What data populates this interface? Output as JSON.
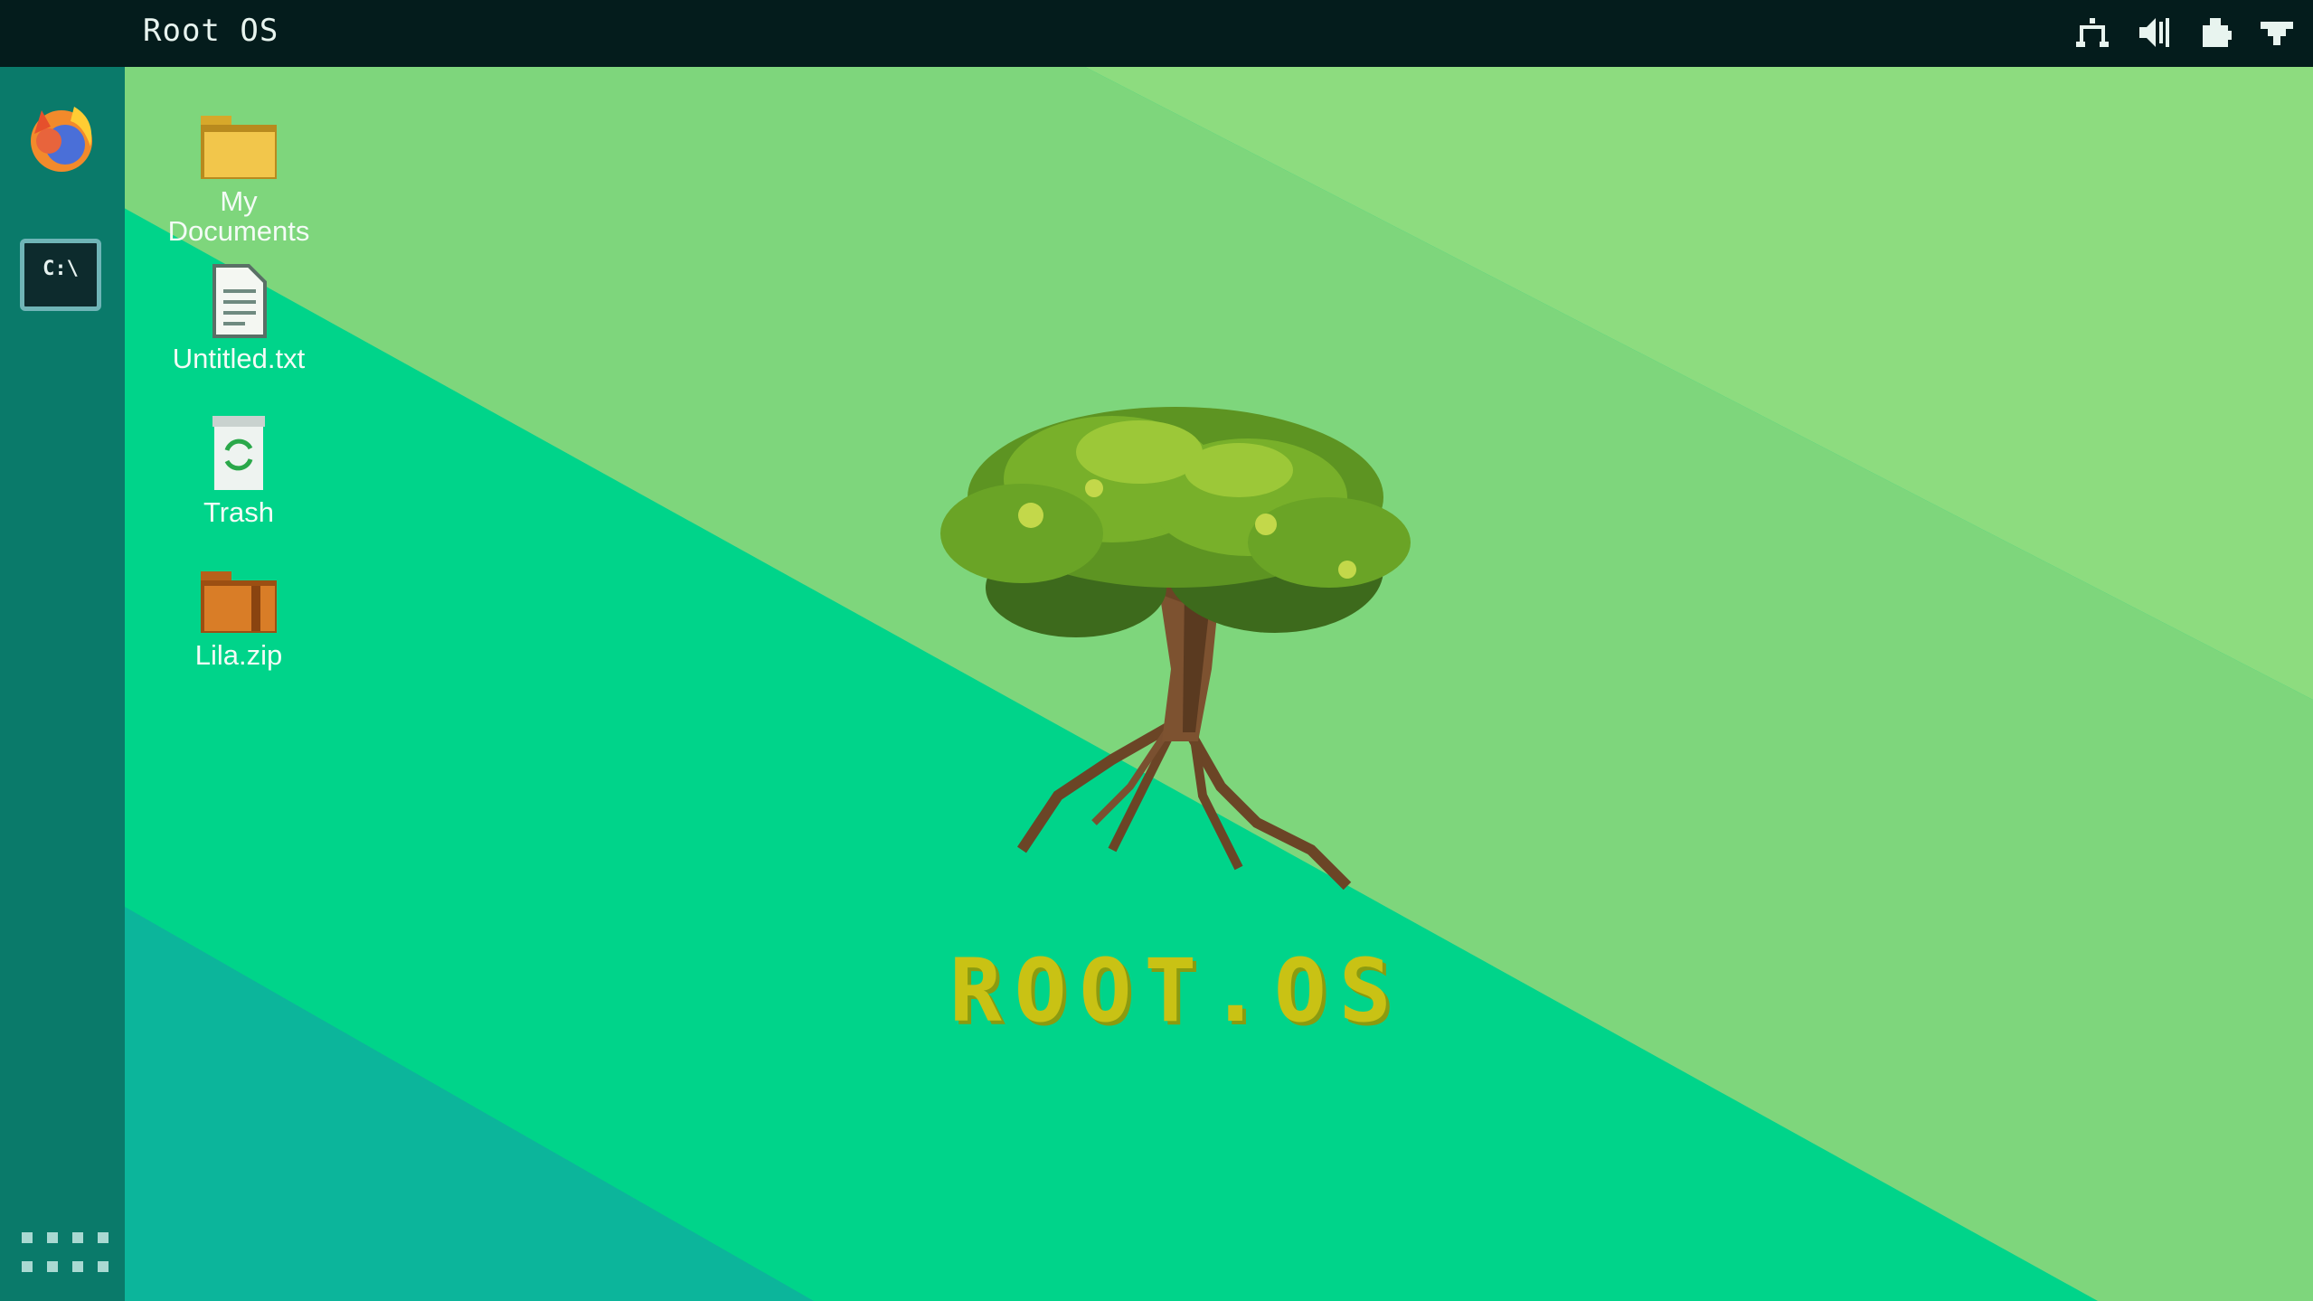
{
  "app": {
    "title": "Root OS"
  },
  "tray": {
    "icons": [
      "network-icon",
      "volume-icon",
      "extensions-icon",
      "power-icon"
    ]
  },
  "dock": {
    "items": [
      {
        "name": "firefox",
        "icon": "firefox-icon"
      },
      {
        "name": "terminal",
        "icon": "terminal-icon",
        "label": "C:\\"
      }
    ],
    "app_grid_icon": "app-grid-icon"
  },
  "desktop": {
    "icons": [
      {
        "label": "My Documents",
        "icon": "folder-icon"
      },
      {
        "label": "Untitled.txt",
        "icon": "text-file-icon"
      },
      {
        "label": "Trash",
        "icon": "trash-icon"
      },
      {
        "label": "Lila.zip",
        "icon": "zip-archive-icon"
      }
    ],
    "wallpaper": {
      "logo_text": "ROOT.OS"
    }
  },
  "colors": {
    "topbar": "#041c1c",
    "dock": "#0a7a6a",
    "wall_light": "#8ddc7f",
    "wall_mid": "#7ed67c",
    "wall_green": "#00d48a",
    "wall_teal": "#0cb59b",
    "logo": "#c9c214"
  }
}
